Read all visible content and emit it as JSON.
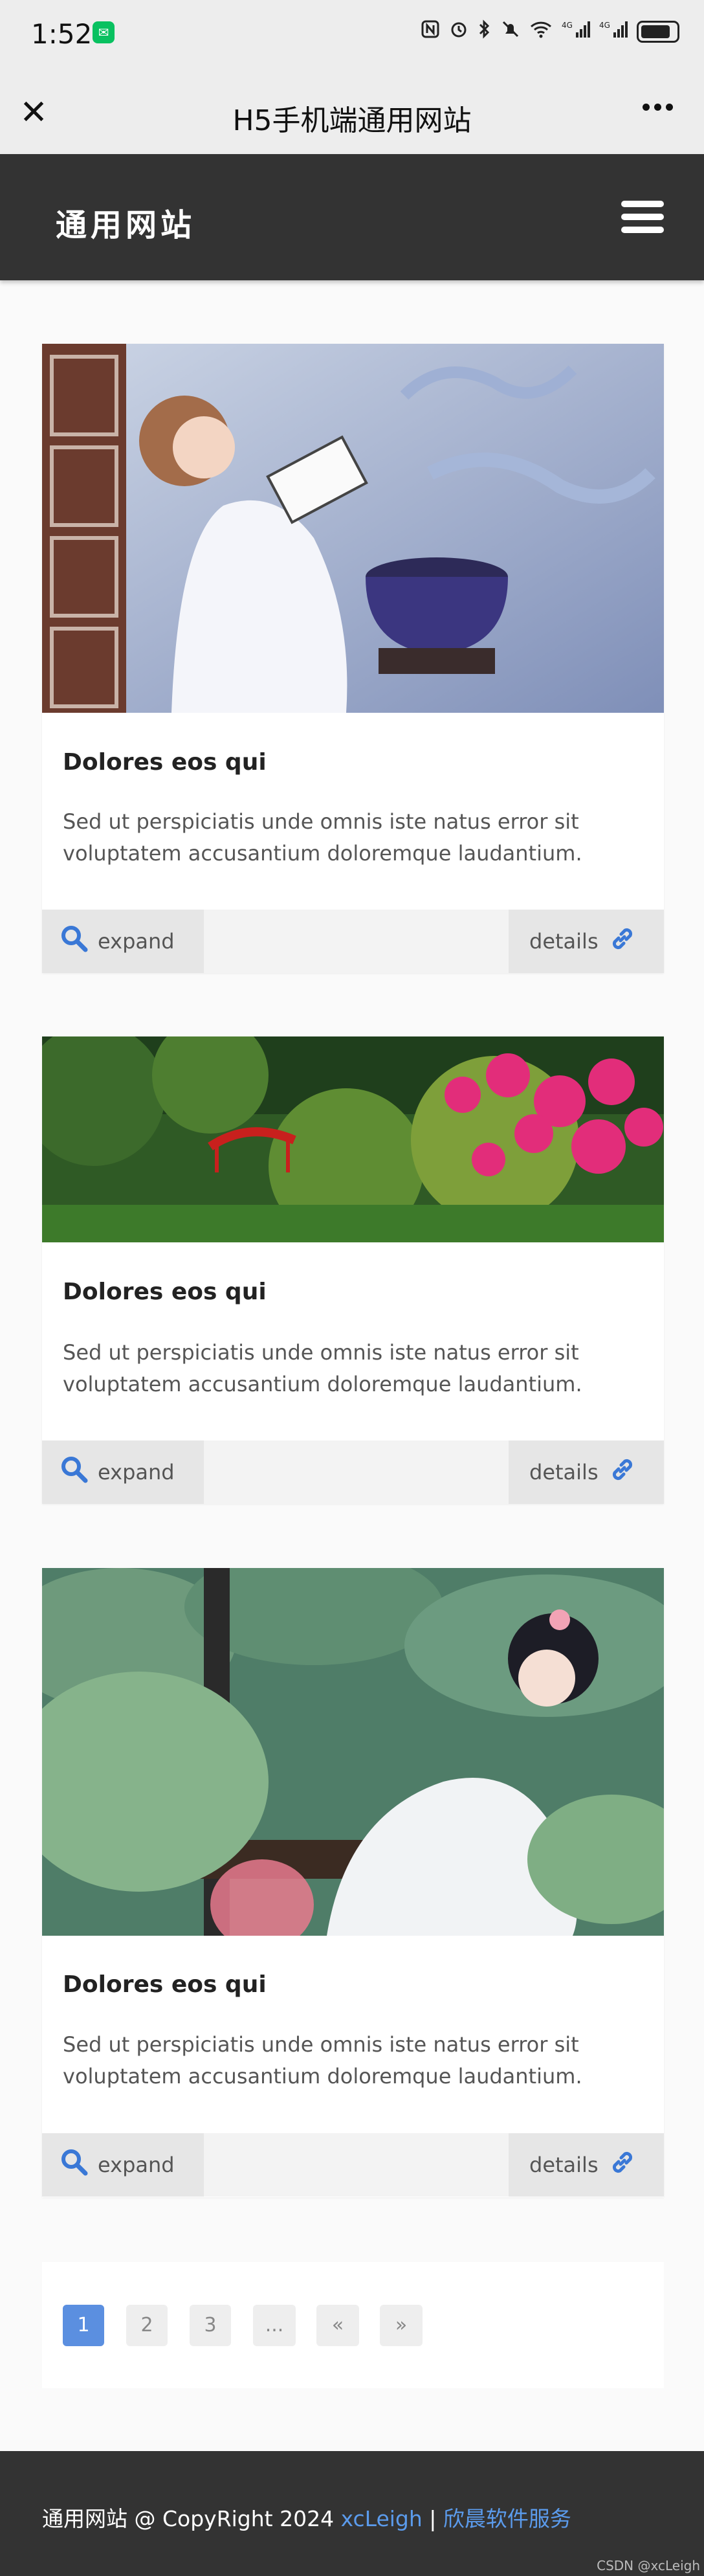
{
  "status": {
    "time": "1:52",
    "wechat_glyph": "✉",
    "net1": "4G",
    "net2": "4G"
  },
  "titlebar": {
    "title": "H5手机端通用网站",
    "close_glyph": "✕"
  },
  "navbar": {
    "brand": "通用网站"
  },
  "cards": [
    {
      "title": "Dolores eos qui",
      "text": "Sed ut perspiciatis unde omnis iste natus error sit voluptatem accusantium doloremque laudantium.",
      "expand": "expand",
      "details": "details"
    },
    {
      "title": "Dolores eos qui",
      "text": "Sed ut perspiciatis unde omnis iste natus error sit voluptatem accusantium doloremque laudantium.",
      "expand": "expand",
      "details": "details"
    },
    {
      "title": "Dolores eos qui",
      "text": "Sed ut perspiciatis unde omnis iste natus error sit voluptatem accusantium doloremque laudantium.",
      "expand": "expand",
      "details": "details"
    }
  ],
  "pagination": {
    "items": [
      "1",
      "2",
      "3",
      "...",
      "«",
      "»"
    ],
    "current": "1"
  },
  "footer": {
    "prefix": "通用网站 @ CopyRight 2024 ",
    "author": "xcLeigh",
    "sep": " | ",
    "company": "欣晨软件服务",
    "watermark": "CSDN @xcLeigh"
  },
  "colors": {
    "accent": "#5b8fe0",
    "dark": "#333333",
    "link": "#5b9bec"
  }
}
